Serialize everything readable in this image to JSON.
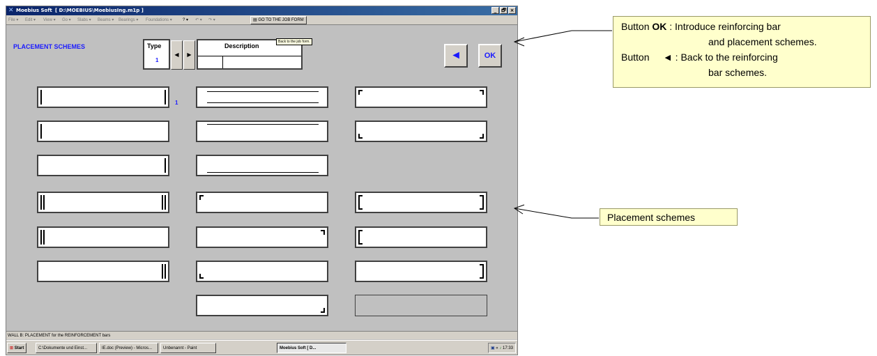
{
  "window": {
    "app_name": "Moebius Soft",
    "file_path": "[ D:\\MOEBIUS\\MoebiusIng.m1p ]",
    "controls": [
      "_",
      "🗗",
      "×"
    ]
  },
  "menu": {
    "items": [
      "File ▾",
      "Edit ▾",
      "View ▾",
      "Go ▾",
      "Slabs ▾",
      "Beams ▾",
      "Bearings ▾",
      "Foundations ▾",
      "? ▾",
      "↶ ▾",
      "↷ ▾"
    ],
    "job_form_button": "GO TO THE JOB FORM",
    "tooltip": "Back to the job form."
  },
  "form": {
    "section_title": "PLACEMENT SCHEMES",
    "type_label": "Type",
    "type_value": "1",
    "description_label": "Description",
    "back_symbol": "◄",
    "ok_label": "OK",
    "scheme_suffix": "1"
  },
  "status": {
    "text": "WALL B: PLACEMENT for the REINFORCEMENT bars"
  },
  "taskbar": {
    "start": "Start",
    "items": [
      "C:\\Dokumente und Einst...",
      "IE.doc (Preview) - Micros...",
      "Unbenannt - Paint",
      "Moebius Soft     [ D..."
    ],
    "tray_time": "17:33"
  },
  "annotations": {
    "ok_callout": {
      "line1_prefix": "Button ",
      "line1_bold": "OK",
      "line1_rest": " : Introduce reinforcing bar",
      "line2": "and placement schemes.",
      "line3": "Button     ◄ : Back to the reinforcing",
      "line4": "bar schemes."
    },
    "placement_callout": "Placement schemes"
  },
  "colors": {
    "window_bg": "#c0c0c0",
    "accent": "#1a1aff",
    "callout_bg": "#ffffcc"
  }
}
